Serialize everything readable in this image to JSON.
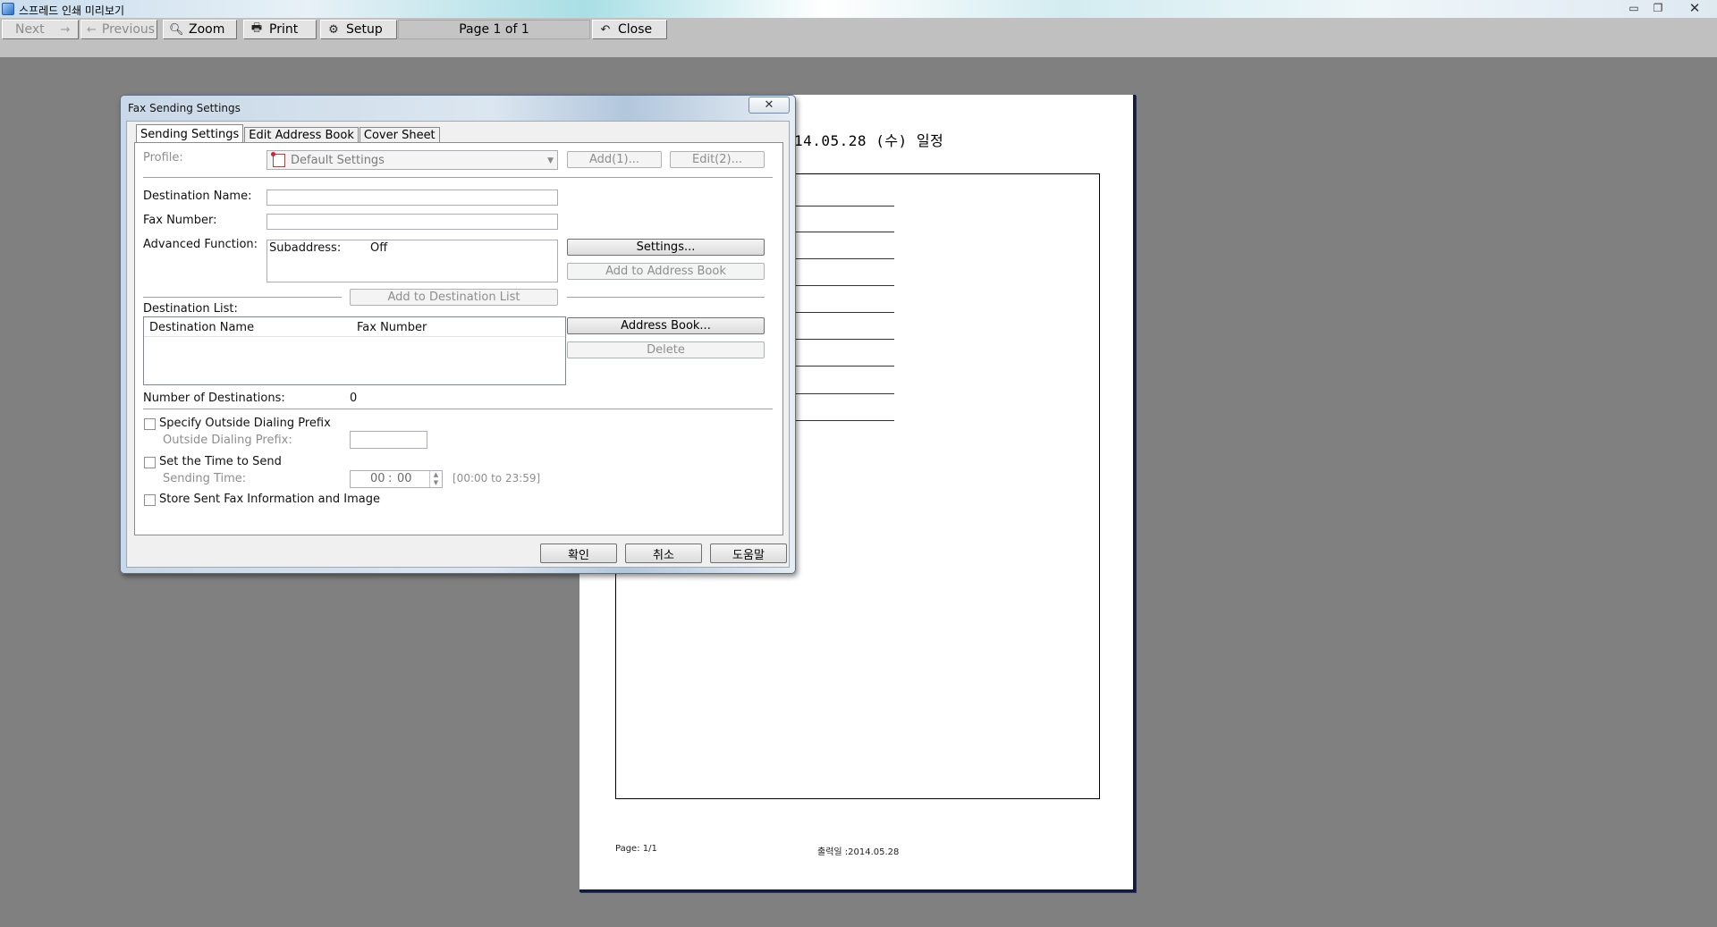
{
  "window": {
    "title": "스프레드 인쇄 미리보기",
    "controls": [
      "minimize",
      "maximize",
      "close"
    ]
  },
  "toolbar": {
    "next": "Next",
    "previous": "Previous",
    "zoom": "Zoom",
    "print": "Print",
    "setup": "Setup",
    "page_indicator": "Page 1 of 1",
    "close": "Close"
  },
  "preview": {
    "heading": "14.05.28 (수) 일정",
    "footer_page": "Page:  1/1",
    "footer_date": "출력일 :2014.05.28"
  },
  "dialog": {
    "title": "Fax Sending Settings",
    "tabs": [
      "Sending Settings",
      "Edit Address Book",
      "Cover Sheet"
    ],
    "profile": {
      "label": "Profile:",
      "value": "Default Settings"
    },
    "add_button": "Add(1)...",
    "edit_button": "Edit(2)...",
    "destination_name": {
      "label": "Destination Name:",
      "value": ""
    },
    "fax_number": {
      "label": "Fax Number:",
      "value": ""
    },
    "advanced_function": {
      "label": "Advanced Function:",
      "subaddress_label": "Subaddress:",
      "subaddress_value": "Off"
    },
    "settings_button": "Settings...",
    "add_to_address_book": "Add to Address Book",
    "add_to_destination_list": "Add to Destination List",
    "destination_list": {
      "label": "Destination List:",
      "columns": [
        "Destination Name",
        "Fax Number"
      ],
      "rows": []
    },
    "address_book_button": "Address Book...",
    "delete_button": "Delete",
    "number_of_destinations": {
      "label": "Number of Destinations:",
      "value": "0"
    },
    "outside_dialing": {
      "checkbox": "Specify Outside Dialing Prefix",
      "checked": false,
      "prefix_label": "Outside Dialing Prefix:",
      "prefix_value": ""
    },
    "time_to_send": {
      "checkbox": "Set the Time to Send",
      "checked": false,
      "time_label": "Sending Time:",
      "hours": "00",
      "separator": ":",
      "minutes": "00",
      "range": "[00:00 to 23:59]"
    },
    "store_info": {
      "checkbox": "Store Sent Fax Information and Image",
      "checked": false
    },
    "ok": "확인",
    "cancel": "취소",
    "help": "도움말"
  }
}
